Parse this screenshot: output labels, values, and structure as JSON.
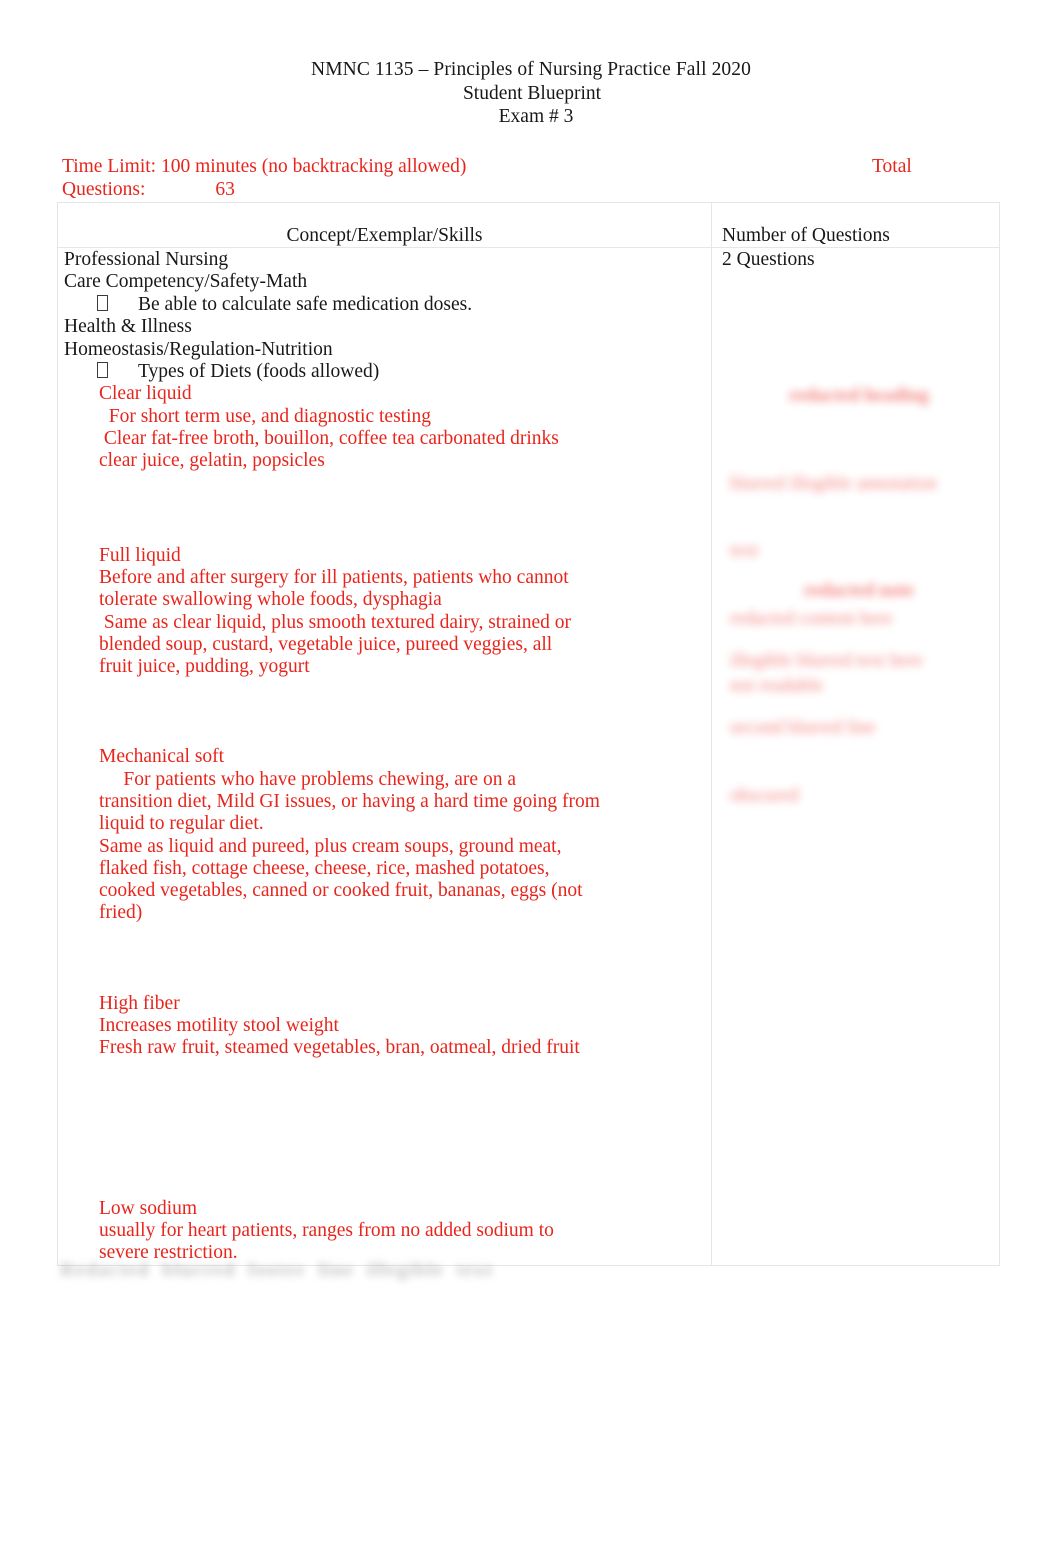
{
  "header": {
    "line1": "NMNC 1135 – Principles of Nursing Practice Fall 2020",
    "line2": "Student Blueprint",
    "line3": "Exam # 3"
  },
  "meta": {
    "time_limit": "Time Limit: 100 minutes (no backtracking allowed)",
    "questions_label": "Questions:",
    "questions_value": "63",
    "total_label": "Total",
    "accent_color": "#e8251c"
  },
  "table": {
    "headers": {
      "concept": "Concept/Exemplar/Skills",
      "count": "Number of Questions"
    },
    "concept_column": {
      "topic_1": "Professional Nursing",
      "topic_1_sub": "Care Competency/Safety-Math",
      "topic_1_bullet": "Be able to calculate safe medication doses.",
      "topic_2": "Health & Illness",
      "topic_2_sub": "Homeostasis/Regulation-Nutrition",
      "topic_2_bullet": "Types of Diets (foods allowed)",
      "diets": [
        {
          "name": "Clear liquid",
          "lines": [
            "  For short term use, and diagnostic testing",
            " Clear fat-free broth, bouillon, coffee tea carbonated drinks",
            "clear juice, gelatin, popsicles"
          ]
        },
        {
          "name": "Full liquid",
          "lines": [
            "Before and after surgery for ill patients, patients who cannot",
            "tolerate swallowing whole foods, dysphagia",
            " Same as clear liquid, plus smooth textured dairy, strained or",
            "blended soup, custard, vegetable juice, pureed veggies, all",
            "fruit juice, pudding, yogurt"
          ]
        },
        {
          "name": "Mechanical soft",
          "lines": [
            "     For patients who have problems chewing, are on a",
            "transition diet, Mild GI issues, or having a hard time going from",
            "liquid to regular diet.",
            "Same as liquid and pureed, plus cream soups, ground meat,",
            "flaked fish, cottage cheese, cheese, rice, mashed potatoes,",
            "cooked vegetables, canned or cooked fruit, bananas, eggs (not",
            "fried)"
          ]
        },
        {
          "name": "High fiber",
          "lines": [
            "Increases motility stool weight",
            "Fresh raw fruit, steamed vegetables, bran, oatmeal, dried fruit"
          ]
        },
        {
          "name": "Low sodium",
          "lines": [
            "usually for heart patients, ranges from no added sodium to",
            "severe restriction."
          ]
        }
      ]
    },
    "count_column": {
      "value": "2 Questions",
      "notes": [
        {
          "title": "redacted heading",
          "lines": [
            "blurred illegible annotation",
            "text",
            "redacted content here",
            "not readable"
          ]
        },
        {
          "title": "redacted note",
          "lines": [
            "illegible blurred text here",
            "second blurred line",
            "obscured"
          ]
        }
      ]
    }
  },
  "footer": {
    "blurred_text": "Redacted  blurred  footer  line  illegible  text"
  }
}
